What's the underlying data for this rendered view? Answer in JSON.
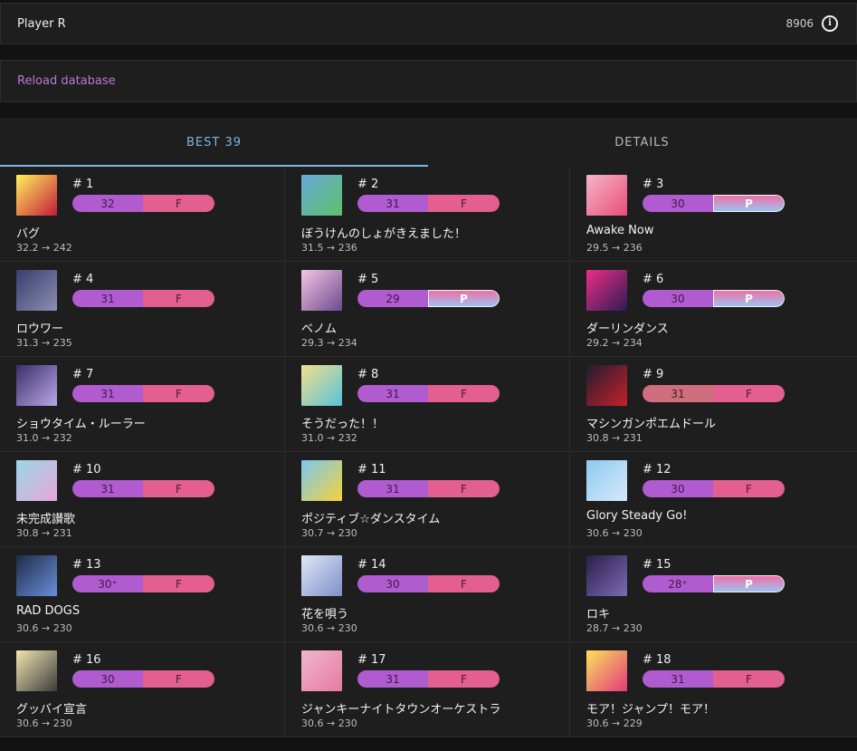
{
  "player": {
    "name": "Player R",
    "rating": "8906"
  },
  "actions": {
    "reload": "Reload database"
  },
  "tabs": [
    {
      "label": "BEST 39",
      "active": true
    },
    {
      "label": "DETAILS",
      "active": false
    }
  ],
  "songs": [
    {
      "rank": "# 1",
      "level": "32",
      "status": "F",
      "title": "バグ",
      "rating": "32.2 → 242",
      "colors": [
        "#fff25a",
        "#c41a3a"
      ]
    },
    {
      "rank": "# 2",
      "level": "31",
      "status": "F",
      "title": "ぼうけんのしょがきえました！",
      "rating": "31.5 → 236",
      "colors": [
        "#6aa9d8",
        "#5cc06a"
      ]
    },
    {
      "rank": "# 3",
      "level": "30",
      "status": "P",
      "title": "Awake Now",
      "rating": "29.5 → 236",
      "colors": [
        "#f4b6c8",
        "#ea4d78"
      ]
    },
    {
      "rank": "# 4",
      "level": "31",
      "status": "F",
      "title": "ロウワー",
      "rating": "31.3 → 235",
      "colors": [
        "#3a3d6e",
        "#8b8fb0"
      ]
    },
    {
      "rank": "# 5",
      "level": "29",
      "status": "P",
      "title": "ベノム",
      "rating": "29.3 → 234",
      "colors": [
        "#f3c6e4",
        "#6c4a8e"
      ]
    },
    {
      "rank": "# 6",
      "level": "30",
      "status": "P",
      "title": "ダーリンダンス",
      "rating": "29.2 → 234",
      "colors": [
        "#ee2e86",
        "#2b1c55"
      ]
    },
    {
      "rank": "# 7",
      "level": "31",
      "status": "F",
      "title": "ショウタイム・ルーラー",
      "rating": "31.0 → 232",
      "colors": [
        "#3a2f6b",
        "#b9a6e6"
      ]
    },
    {
      "rank": "# 8",
      "level": "31",
      "status": "F",
      "title": "そうだった！！",
      "rating": "31.0 → 232",
      "colors": [
        "#f3e08a",
        "#57c2d8"
      ]
    },
    {
      "rank": "# 9",
      "level": "31",
      "status": "F",
      "title": "マシンガンポエムドール",
      "rating": "30.8 → 231",
      "colors": [
        "#1e1e2e",
        "#c8202c"
      ],
      "alt": true
    },
    {
      "rank": "# 10",
      "level": "31",
      "status": "F",
      "title": "未完成讃歌",
      "rating": "30.8 → 231",
      "colors": [
        "#9ad8e8",
        "#e6a6d6"
      ]
    },
    {
      "rank": "# 11",
      "level": "31",
      "status": "F",
      "title": "ポジティブ☆ダンスタイム",
      "rating": "30.7 → 230",
      "colors": [
        "#78c8f0",
        "#f5d23c"
      ]
    },
    {
      "rank": "# 12",
      "level": "30",
      "status": "F",
      "title": "Glory Steady Go!",
      "rating": "30.6 → 230",
      "colors": [
        "#8ec9f2",
        "#d7e9fb"
      ]
    },
    {
      "rank": "# 13",
      "level": "30⁺",
      "status": "F",
      "title": "RAD DOGS",
      "rating": "30.6 → 230",
      "colors": [
        "#1f2a4a",
        "#6a8fd8"
      ]
    },
    {
      "rank": "# 14",
      "level": "30",
      "status": "F",
      "title": "花を唄う",
      "rating": "30.6 → 230",
      "colors": [
        "#dfe8f7",
        "#7d8fc9"
      ]
    },
    {
      "rank": "# 15",
      "level": "28⁺",
      "status": "P",
      "title": "ロキ",
      "rating": "28.7 → 230",
      "colors": [
        "#2a1f47",
        "#7c6ab8"
      ]
    },
    {
      "rank": "# 16",
      "level": "30",
      "status": "F",
      "title": "グッバイ宣言",
      "rating": "30.6 → 230",
      "colors": [
        "#f2e6b0",
        "#3b3b3b"
      ]
    },
    {
      "rank": "# 17",
      "level": "31",
      "status": "F",
      "title": "ジャンキーナイトタウンオーケストラ",
      "rating": "30.6 → 230",
      "colors": [
        "#f0b7cc",
        "#e67aa2"
      ]
    },
    {
      "rank": "# 18",
      "level": "31",
      "status": "F",
      "title": "モア！ジャンプ！モア！",
      "rating": "30.6 → 229",
      "colors": [
        "#fbe25a",
        "#e13b7b"
      ]
    }
  ]
}
